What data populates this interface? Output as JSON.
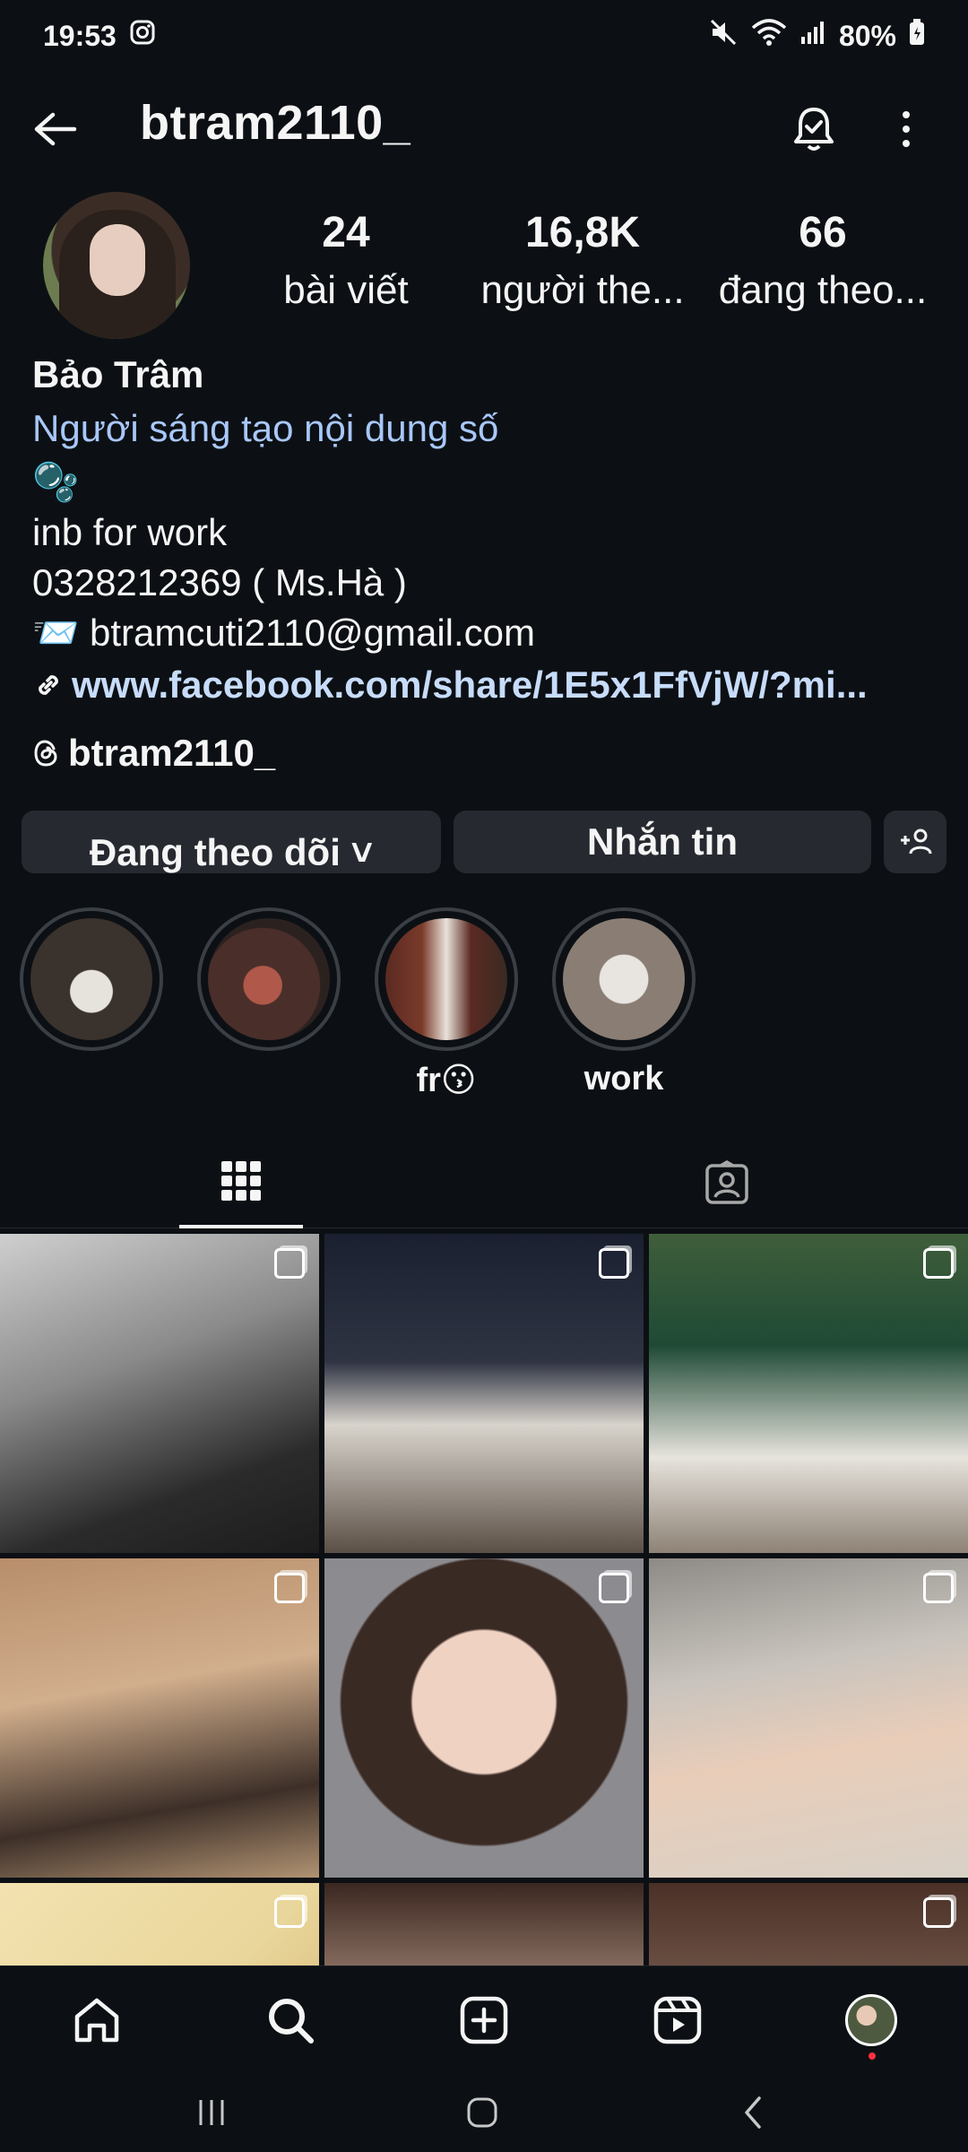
{
  "status_bar": {
    "time": "19:53",
    "battery": "80%"
  },
  "header": {
    "username": "btram2110_"
  },
  "profile": {
    "stats": [
      {
        "value": "24",
        "label": "bài viết"
      },
      {
        "value": "16,8K",
        "label": "người the..."
      },
      {
        "value": "66",
        "label": "đang theo..."
      }
    ],
    "name": "Bảo Trâm",
    "category": "Người sáng tạo nội dung số",
    "bio_emoji": "🫧",
    "bio_lines": [
      "inb for work",
      " 0328212369 ( Ms.Hà )",
      "📨 btramcuti2110@gmail.com"
    ],
    "link": "www.facebook.com/share/1E5x1FfVjW/?mi...",
    "threads_handle": "btram2110_"
  },
  "actions": {
    "follow_label": "Đang theo dõi ˅",
    "message_label": "Nhắn tin"
  },
  "highlights": [
    {
      "label": "",
      "color": "#3a322c"
    },
    {
      "label": "",
      "color": "#4a2e2a"
    },
    {
      "label": "fr😗",
      "color": "#5a2a22"
    },
    {
      "label": "work",
      "color": "#8a7d74"
    }
  ],
  "icons": {
    "back": "arrow-left-icon",
    "bell": "bell-check-icon",
    "more": "more-vertical-icon",
    "link": "link-icon",
    "threads": "threads-icon",
    "add_user": "add-user-icon",
    "grid": "grid-icon",
    "tagged": "tagged-icon",
    "home": "home-icon",
    "search": "search-icon",
    "create": "create-icon",
    "reels": "reels-icon"
  }
}
